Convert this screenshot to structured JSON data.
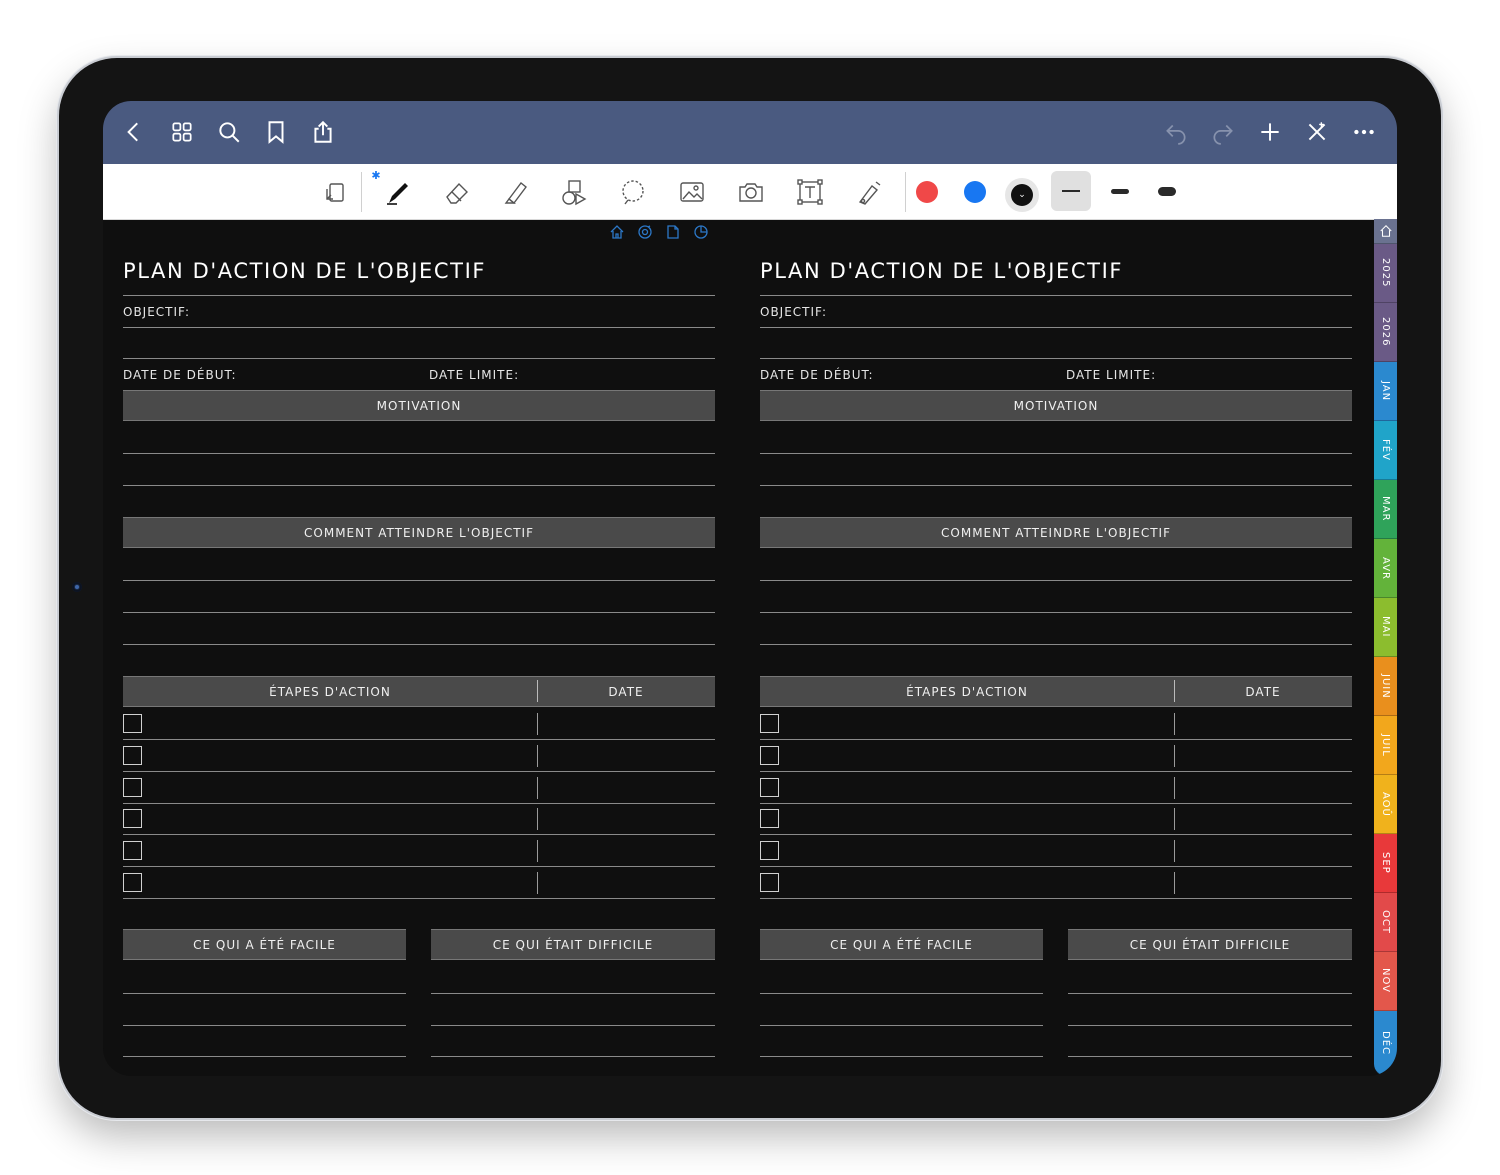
{
  "page": {
    "title": "PLAN D'ACTION DE L'OBJECTIF",
    "objective_label": "OBJECTIF:",
    "start_date_label": "DATE DE DÉBUT:",
    "deadline_label": "DATE LIMITE:",
    "motivation_label": "MOTIVATION",
    "how_label": "COMMENT ATTEINDRE L'OBJECTIF",
    "steps_label": "ÉTAPES D'ACTION",
    "date_label": "DATE",
    "easy_label": "CE QUI A ÉTÉ FACILE",
    "hard_label": "CE QUI ÉTAIT DIFFICILE"
  },
  "nav": {
    "icons": [
      "chevron-left-icon",
      "grid-icon",
      "search-icon",
      "bookmark-icon",
      "share-icon",
      "undo-icon",
      "redo-icon",
      "plus-icon",
      "close-x-icon",
      "more-icon"
    ]
  },
  "toolbar": {
    "tools": [
      "read-mode-icon",
      "pen-icon",
      "eraser-icon",
      "highlighter-icon",
      "shapes-icon",
      "lasso-icon",
      "image-icon",
      "camera-icon",
      "text-icon",
      "laser-pointer-icon"
    ],
    "colors": {
      "red": "#f04848",
      "blue": "#1877f2",
      "black": "#111111"
    },
    "bluetooth_mark": "✱"
  },
  "tabs": {
    "items": [
      {
        "label": "2025",
        "color": "#6a5a86"
      },
      {
        "label": "2026",
        "color": "#6a5a86"
      },
      {
        "label": "JAN",
        "color": "#2b89cf"
      },
      {
        "label": "FÉV",
        "color": "#20a4c9"
      },
      {
        "label": "MAR",
        "color": "#2fa35a"
      },
      {
        "label": "AVR",
        "color": "#63b33a"
      },
      {
        "label": "MAI",
        "color": "#8cbd2e"
      },
      {
        "label": "JUIN",
        "color": "#e98f1d"
      },
      {
        "label": "JUIL",
        "color": "#f2a71c"
      },
      {
        "label": "AOÛ",
        "color": "#f0b21c"
      },
      {
        "label": "SEP",
        "color": "#e8393a"
      },
      {
        "label": "OCT",
        "color": "#e24a4a"
      },
      {
        "label": "NOV",
        "color": "#e3574b"
      },
      {
        "label": "DÉC",
        "color": "#2b89cf"
      }
    ],
    "home_color": "#6a7290"
  }
}
